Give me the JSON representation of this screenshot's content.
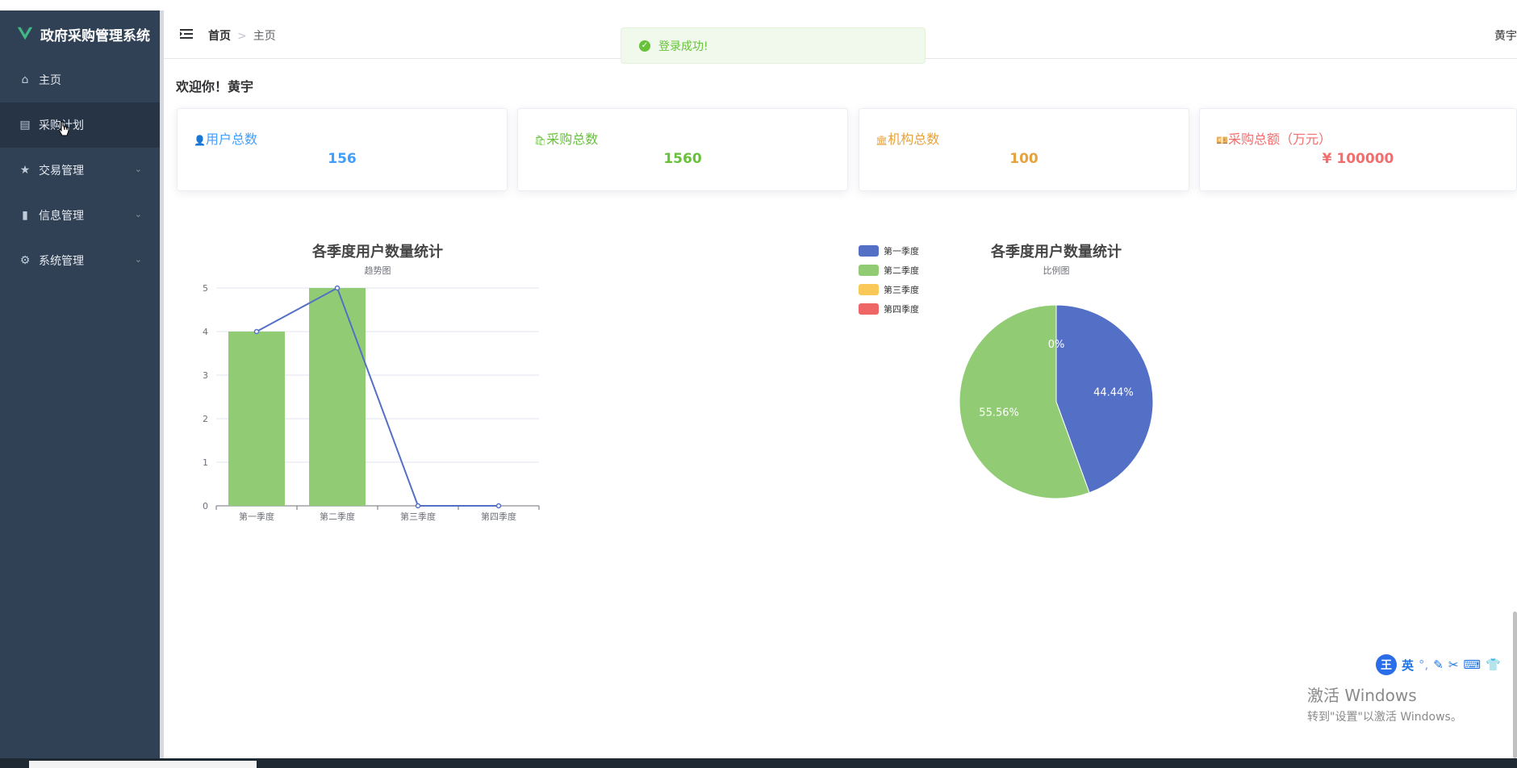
{
  "app": {
    "title": "政府采购管理系统"
  },
  "sidebar": {
    "items": [
      {
        "label": "主页",
        "icon": "home-icon",
        "expandable": false
      },
      {
        "label": "采购计划",
        "icon": "document-icon",
        "expandable": false,
        "active": true
      },
      {
        "label": "交易管理",
        "icon": "star-icon",
        "expandable": true
      },
      {
        "label": "信息管理",
        "icon": "bar-chart-icon",
        "expandable": true
      },
      {
        "label": "系统管理",
        "icon": "gear-icon",
        "expandable": true
      }
    ]
  },
  "header": {
    "breadcrumb": [
      "首页",
      "主页"
    ],
    "user": "黄宇"
  },
  "toast": {
    "message": "登录成功!"
  },
  "main": {
    "welcome": "欢迎你！黄宇",
    "cards": [
      {
        "label": "用户总数",
        "icon": "user-icon",
        "value": "156",
        "color": "#409eff"
      },
      {
        "label": "采购总数",
        "icon": "bag-icon",
        "value": "1560",
        "color": "#67c23a"
      },
      {
        "label": "机构总数",
        "icon": "bank-icon",
        "value": "100",
        "color": "#e6a23c"
      },
      {
        "label": "采购总额（万元）",
        "icon": "money-icon",
        "value": "¥ 100000",
        "color": "#f56c6c"
      }
    ]
  },
  "chart_data": [
    {
      "type": "bar",
      "title": "各季度用户数量统计",
      "subtitle": "趋势图",
      "categories": [
        "第一季度",
        "第二季度",
        "第三季度",
        "第四季度"
      ],
      "series": [
        {
          "type": "bar",
          "values": [
            4,
            5,
            0,
            0
          ],
          "color": "#91cc75"
        },
        {
          "type": "line",
          "values": [
            4,
            5,
            0,
            0
          ],
          "color": "#5470c6"
        }
      ],
      "ylim": [
        0,
        5
      ],
      "yticks": [
        0,
        1,
        2,
        3,
        4,
        5
      ],
      "grid": true
    },
    {
      "type": "pie",
      "title": "各季度用户数量统计",
      "subtitle": "比例图",
      "legend_position": "left",
      "slices": [
        {
          "label": "第一季度",
          "value": 4,
          "percent": "44.44%",
          "color": "#5470c6"
        },
        {
          "label": "第二季度",
          "value": 5,
          "percent": "55.56%",
          "color": "#91cc75"
        },
        {
          "label": "第三季度",
          "value": 0,
          "percent": "0%",
          "color": "#fac858"
        },
        {
          "label": "第四季度",
          "value": 0,
          "percent": "0%",
          "color": "#ee6666"
        }
      ]
    }
  ],
  "system": {
    "ime": {
      "logo": "王",
      "lang": "英"
    },
    "watermark": {
      "line1": "激活 Windows",
      "line2": "转到\"设置\"以激活 Windows。"
    }
  }
}
